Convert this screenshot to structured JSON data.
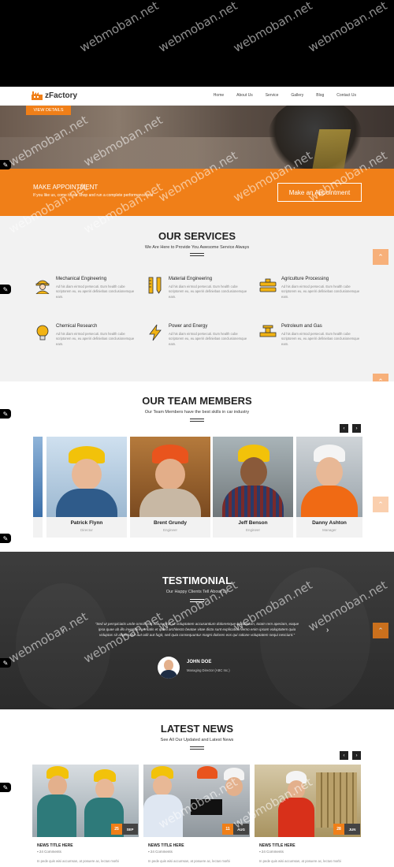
{
  "watermark": "webmoban.net",
  "brand": {
    "name": "zFactory",
    "accent": "#f07f18"
  },
  "nav": {
    "items": [
      "Home",
      "About Us",
      "Service",
      "Gallery",
      "Blog",
      "Contact Us"
    ]
  },
  "hero": {
    "button": "VIEW DETAILS"
  },
  "appointment": {
    "title": "MAKE APPOINTMENT",
    "subtitle": "If you like us, come to our shop and run a complete performance test",
    "button": "Make an Appointment"
  },
  "services": {
    "title": "OUR SERVICES",
    "subtitle": "We Are Here to Provide You Awesome Service Always",
    "items": [
      {
        "title": "Mechanical Engineering",
        "icon": "worker-icon",
        "text": "Ad his diam eirmod persecuti. Eum health cube scriptorem eu, eu aperiri definiebas conclusionemque eam."
      },
      {
        "title": "Material Engineering",
        "icon": "ruler-pencil-icon",
        "text": "Ad his diam eirmod persecuti. Eum health cube scriptorem eu, eu aperiri definiebas conclusionemque eam."
      },
      {
        "title": "Agriculture Processing",
        "icon": "factory-pipes-icon",
        "text": "Ad his diam eirmod persecuti. Eum health cube scriptorem eu, eu aperiri definiebas conclusionemque eam."
      },
      {
        "title": "Chemical Research",
        "icon": "lightbulb-icon",
        "text": "Ad his diam eirmod persecuti. Eum health cube scriptorem eu, eu aperiri definiebas conclusionemque eam."
      },
      {
        "title": "Power and Energy",
        "icon": "lightning-icon",
        "text": "Ad his diam eirmod persecuti. Eum health cube scriptorem eu, eu aperiri definiebas conclusionemque eam."
      },
      {
        "title": "Petroleum and Gas",
        "icon": "valve-icon",
        "text": "Ad his diam eirmod persecuti. Eum health cube scriptorem eu, eu aperiri definiebas conclusionemque eam."
      }
    ]
  },
  "team": {
    "title": "OUR TEAM MEMBERS",
    "subtitle": "Our Team Members have the best skills in car industry",
    "members": [
      {
        "name": "Patrick Flynn",
        "role": "Director"
      },
      {
        "name": "Brent Grundy",
        "role": "Engineer"
      },
      {
        "name": "Jeff Benson",
        "role": "Engineer"
      },
      {
        "name": "Danny Ashton",
        "role": "Manager"
      }
    ]
  },
  "testimonial": {
    "title": "TESTIMONIAL",
    "subtitle": "Our Happy Clients Tell About Us",
    "quote": "\"Sed ut perspiciatis unde omnis iste natus error sit voluptatem accusantium doloremque laudantium, totam rem aperiam, eaque ipsa quae ab illo inventore veritatis et quasi architecto beatae vitae dicta sunt explicabo. Nemo enim ipsam voluptatem quia voluptas sit aspernatur aut odit aut fugit, sed quia consequuntur magni dolores eos qui ratione voluptatem sequi nesciunt.\"",
    "name": "JOHN DOE",
    "role": "Managing Director (ABC Inc.)"
  },
  "news": {
    "title": "LATEST NEWS",
    "subtitle": "See All Our Updated and Latest News",
    "items": [
      {
        "day": "25",
        "month": "SEP",
        "title": "NEWS TITLE HERE",
        "comments": "24 Comments",
        "text": "In pede quis wisi accumsan, at posuere ac, lectus morbi"
      },
      {
        "day": "11",
        "month": "AUG",
        "title": "NEWS TITLE HERE",
        "comments": "24 Comments",
        "text": "In pede quis wisi accumsan, at posuere ac, lectus morbi"
      },
      {
        "day": "28",
        "month": "JUN",
        "title": "NEWS TITLE HERE",
        "comments": "24 Comments",
        "text": "In pede quis wisi accumsan, at posuere ac, lectus morbi"
      }
    ]
  }
}
